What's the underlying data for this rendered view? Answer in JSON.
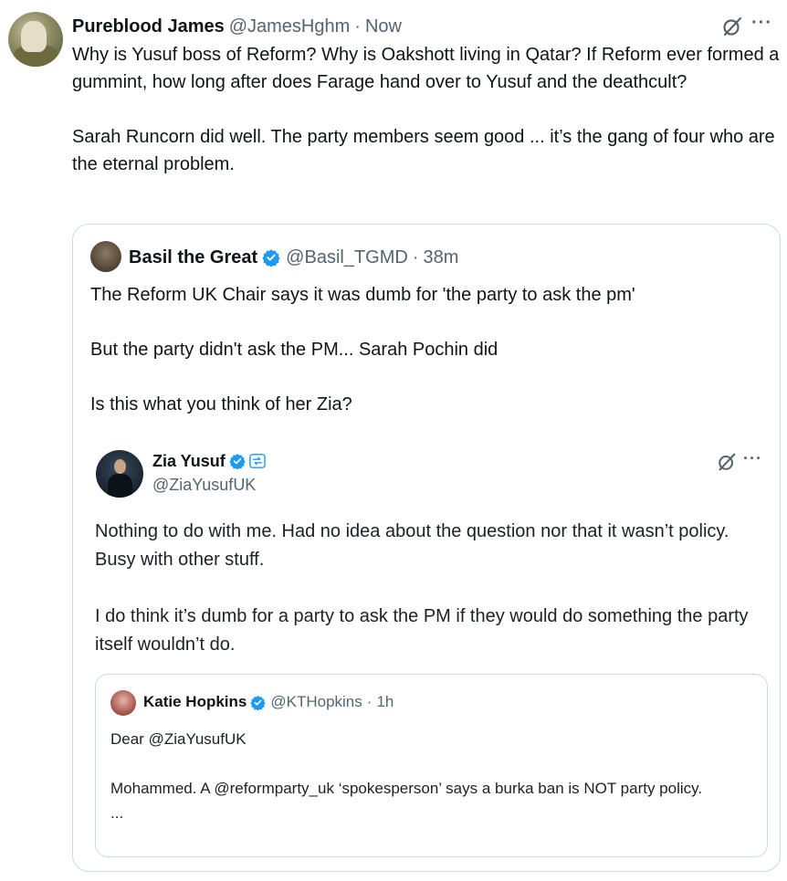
{
  "main_post": {
    "display_name": "Pureblood James",
    "handle": "@JamesHghm",
    "separator": "·",
    "time": "Now",
    "more_label": "···",
    "paragraphs": [
      "Why is Yusuf boss of Reform?  Why is Oakshott living in Qatar? If Reform ever formed a gummint, how long after does Farage hand over to Yusuf and the deathcult?",
      "Sarah Runcorn did well. The party members seem good ...  it’s  the  gang  of four  who  are  the  eternal  problem."
    ]
  },
  "quoted_post": {
    "display_name": "Basil the Great",
    "handle": "@Basil_TGMD",
    "separator": "·",
    "time": "38m",
    "paragraphs": [
      "The Reform UK Chair says it was dumb for 'the party to ask the pm'",
      "But the party didn't ask the PM... Sarah Pochin did",
      "Is this what you think of her Zia?"
    ]
  },
  "embedded_post": {
    "display_name": "Zia Yusuf",
    "handle": "@ZiaYusufUK",
    "more_label": "···",
    "paragraphs": [
      "Nothing to do with me. Had no idea about the question nor that it wasn’t policy. Busy with other stuff.",
      "I do think it’s dumb for a party to ask the PM if they would do something the party itself wouldn’t do."
    ]
  },
  "nested_quote": {
    "display_name": "Katie Hopkins",
    "handle": "@KTHopkins",
    "separator": "·",
    "time": "1h",
    "greeting": "Dear @ZiaYusufUK",
    "body": "Mohammed. A @reformparty_uk ‘spokesperson’ says a burka ban is NOT party policy.",
    "ellipsis": "..."
  },
  "icons": {
    "verified": "verified-badge-icon",
    "grok": "grok-icon",
    "more": "more-icon",
    "affiliate": "affiliate-badge-icon"
  },
  "colors": {
    "verified_blue": "#1d9bf0",
    "secondary_text": "#536471",
    "border": "#cfd9de"
  }
}
